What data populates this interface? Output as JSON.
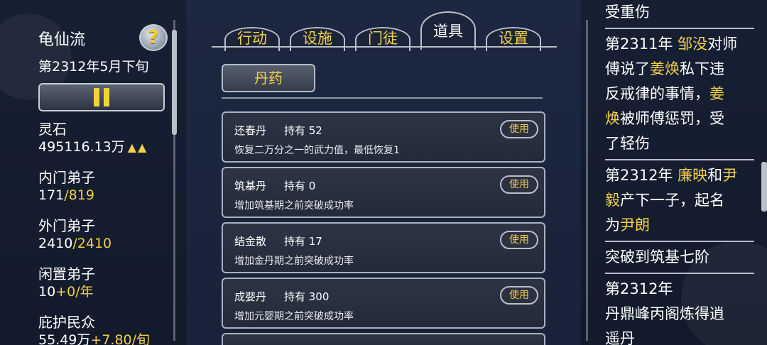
{
  "left": {
    "sect_name": "龟仙流",
    "help_label": "?",
    "date": "第2312年5月下旬",
    "stats": [
      {
        "label": "灵石",
        "value_white": "495116.13万",
        "value_yellow": "",
        "indicator": "▲▲"
      },
      {
        "label": "内门弟子",
        "value_white": "171",
        "value_yellow": "/819",
        "indicator": ""
      },
      {
        "label": "外门弟子",
        "value_white": "2410",
        "value_yellow": "/2410",
        "indicator": ""
      },
      {
        "label": "闲置弟子",
        "value_white": "10",
        "value_yellow": "+0/年",
        "indicator": ""
      },
      {
        "label": "庇护民众",
        "value_white": "55.49万",
        "value_yellow": "+7.80/旬",
        "indicator": ""
      }
    ]
  },
  "center": {
    "tabs": [
      {
        "label": "行动"
      },
      {
        "label": "设施"
      },
      {
        "label": "门徒"
      },
      {
        "label": "道具"
      },
      {
        "label": "设置"
      }
    ],
    "active_tab": "道具",
    "category": "丹药",
    "items": [
      {
        "name": "还春丹",
        "owned": "持有 52",
        "desc": "恢复二万分之一的武力值，最低恢复1",
        "use": "使用"
      },
      {
        "name": "筑基丹",
        "owned": "持有 0",
        "desc": "增加筑基期之前突破成功率",
        "use": "使用"
      },
      {
        "name": "结金散",
        "owned": "持有 17",
        "desc": "增加金丹期之前突破成功率",
        "use": "使用"
      },
      {
        "name": "成婴丹",
        "owned": "持有 300",
        "desc": "增加元婴期之前突破成功率",
        "use": "使用"
      }
    ]
  },
  "right": {
    "entries": [
      {
        "lines": [
          [
            {
              "t": "受重伤",
              "c": "w"
            }
          ]
        ]
      },
      {
        "lines": [
          [
            {
              "t": "第2311年 ",
              "c": "w"
            },
            {
              "t": "邹没",
              "c": "y"
            },
            {
              "t": "对师",
              "c": "w"
            }
          ],
          [
            {
              "t": "傅说了",
              "c": "w"
            },
            {
              "t": "姜焕",
              "c": "y"
            },
            {
              "t": "私下违",
              "c": "w"
            }
          ],
          [
            {
              "t": "反戒律的事情，",
              "c": "w"
            },
            {
              "t": "姜",
              "c": "y"
            }
          ],
          [
            {
              "t": "焕",
              "c": "y"
            },
            {
              "t": "被师傅惩罚，受",
              "c": "w"
            }
          ],
          [
            {
              "t": "了轻伤",
              "c": "w"
            }
          ]
        ]
      },
      {
        "lines": [
          [
            {
              "t": "第2312年 ",
              "c": "w"
            },
            {
              "t": "廉映",
              "c": "y"
            },
            {
              "t": "和",
              "c": "w"
            },
            {
              "t": "尹",
              "c": "y"
            }
          ],
          [
            {
              "t": "毅",
              "c": "y"
            },
            {
              "t": "产下一子，起名",
              "c": "w"
            }
          ],
          [
            {
              "t": "为",
              "c": "w"
            },
            {
              "t": "尹朗",
              "c": "y"
            }
          ]
        ]
      },
      {
        "lines": [
          [
            {
              "t": "突破到筑基七阶",
              "c": "w"
            }
          ]
        ]
      },
      {
        "lines": [
          [
            {
              "t": "第2312年",
              "c": "w"
            }
          ],
          [
            {
              "t": "丹鼎峰丙阁炼得逍",
              "c": "w"
            }
          ],
          [
            {
              "t": "遥丹",
              "c": "w"
            }
          ]
        ]
      }
    ]
  },
  "colors": {
    "accent_yellow": "#f2d04a",
    "panel_bg": "#1c2741",
    "border": "#b7bfca"
  }
}
